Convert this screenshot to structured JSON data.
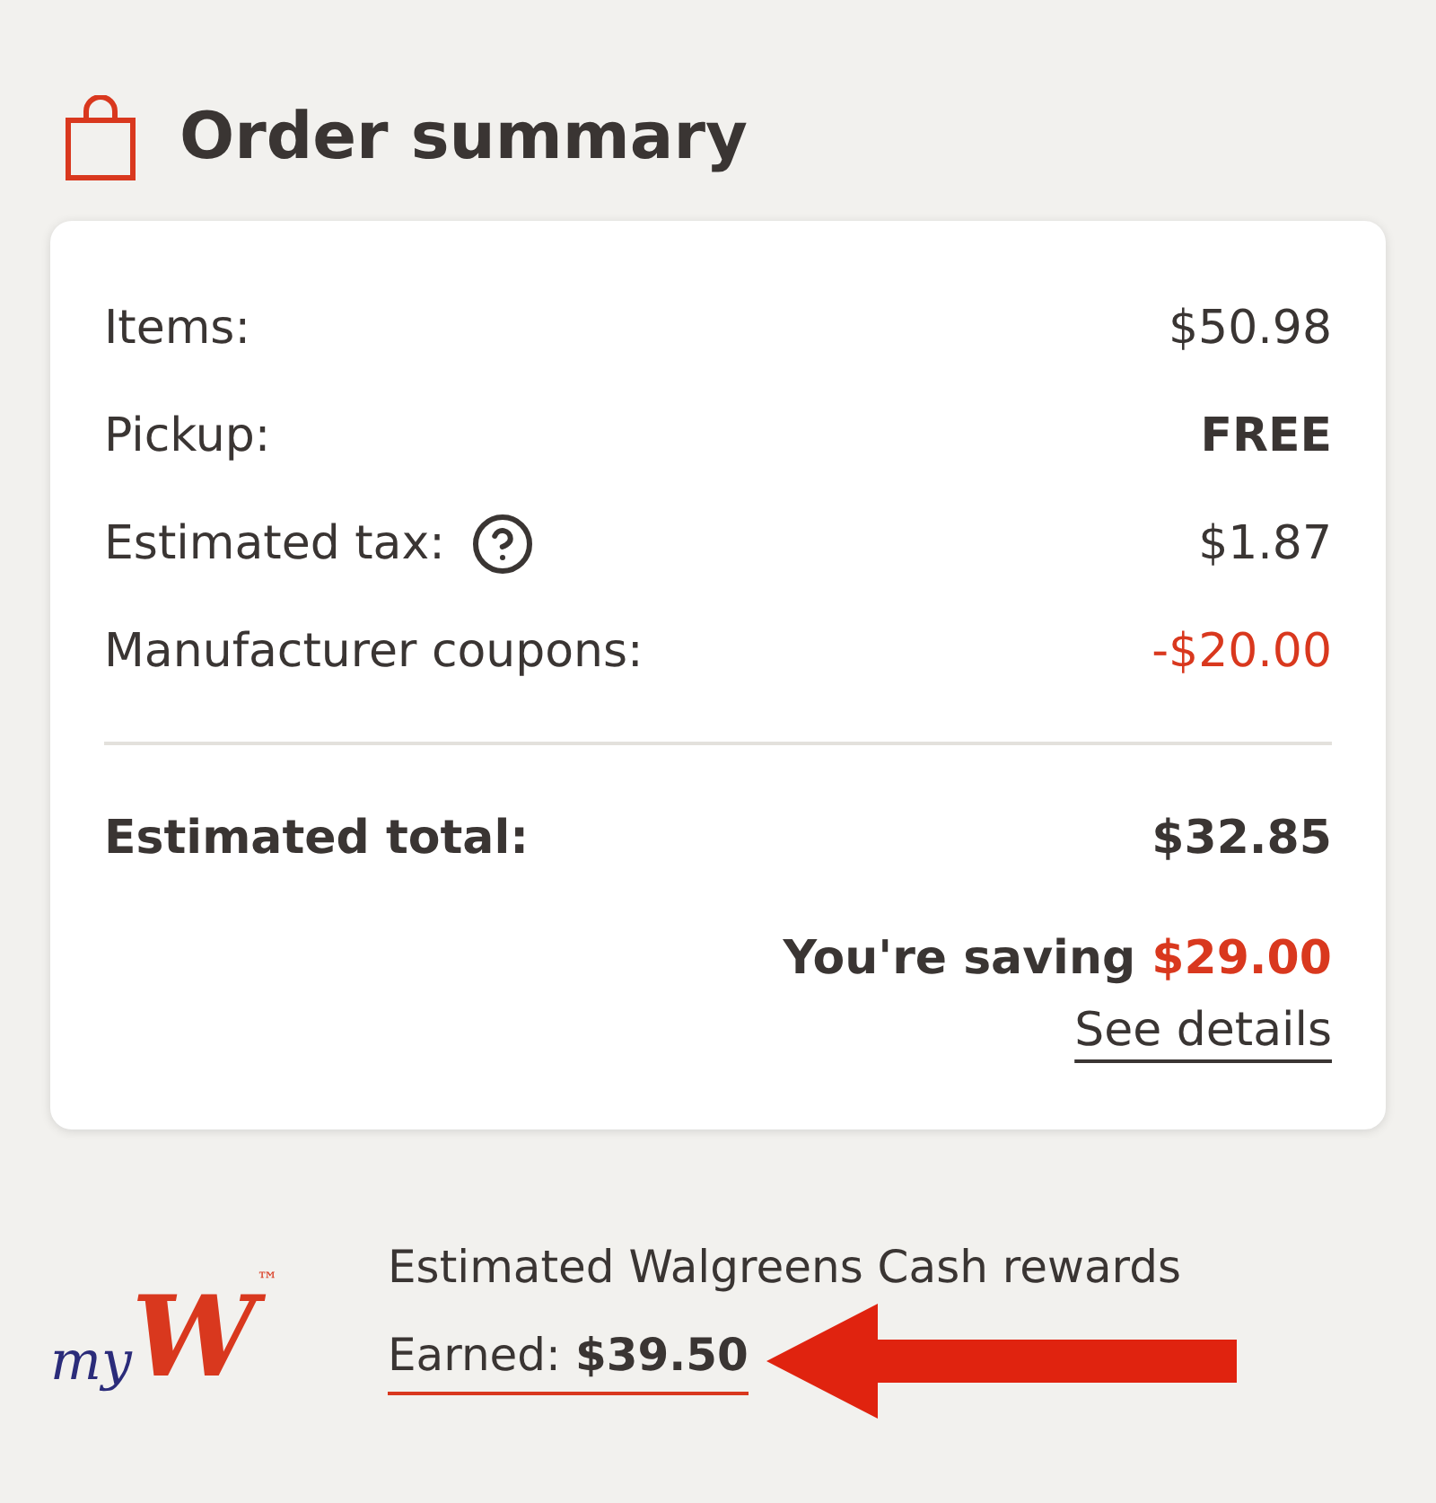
{
  "title": "Order summary",
  "lines": [
    {
      "label": "Items:",
      "value": "$50.98",
      "kind": "plain",
      "help": false
    },
    {
      "label": "Pickup:",
      "value": "FREE",
      "kind": "bold",
      "help": false
    },
    {
      "label": "Estimated tax:",
      "value": "$1.87",
      "kind": "plain",
      "help": true
    },
    {
      "label": "Manufacturer coupons:",
      "value": "-$20.00",
      "kind": "discount",
      "help": false
    }
  ],
  "total": {
    "label": "Estimated total:",
    "value": "$32.85"
  },
  "saving": {
    "label": "You're saving",
    "value": "$29.00"
  },
  "details_link": "See details",
  "rewards": {
    "logo_prefix": "my",
    "logo_mark": "W",
    "logo_tm": "™",
    "heading": "Estimated Walgreens Cash rewards",
    "earned_label": "Earned:",
    "earned_value": "$39.50"
  }
}
